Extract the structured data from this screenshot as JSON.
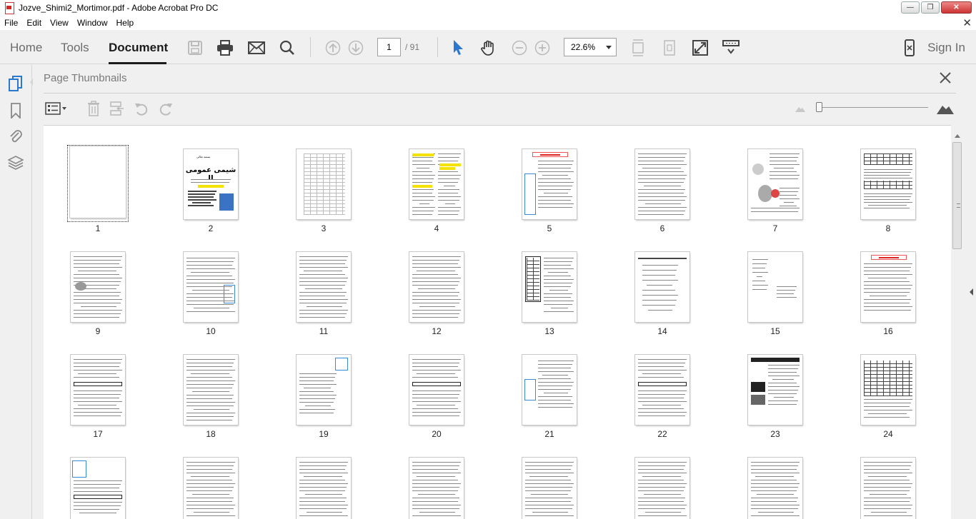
{
  "window": {
    "title": "Jozve_Shimi2_Mortimor.pdf - Adobe Acrobat Pro DC",
    "controls": {
      "minimize": "—",
      "restore": "❐",
      "close": "✕"
    }
  },
  "menu": {
    "items": [
      "File",
      "Edit",
      "View",
      "Window",
      "Help"
    ],
    "close_glyph": "✕"
  },
  "toolbar": {
    "tabs": [
      "Home",
      "Tools",
      "Document"
    ],
    "active_tab": "Document",
    "current_page": "1",
    "page_total": "/ 91",
    "zoom": "22.6%",
    "sign_in": "Sign In"
  },
  "panel": {
    "title": "Page Thumbnails",
    "thumbnail_size_level": 0.0
  },
  "thumbnails": {
    "selected_page": "1",
    "pages": [
      {
        "num": "1"
      },
      {
        "num": "2"
      },
      {
        "num": "3"
      },
      {
        "num": "4"
      },
      {
        "num": "5"
      },
      {
        "num": "6"
      },
      {
        "num": "7"
      },
      {
        "num": "8"
      },
      {
        "num": "9"
      },
      {
        "num": "10"
      },
      {
        "num": "11"
      },
      {
        "num": "12"
      },
      {
        "num": "13"
      },
      {
        "num": "14"
      },
      {
        "num": "15"
      },
      {
        "num": "16"
      },
      {
        "num": "17"
      },
      {
        "num": "18"
      },
      {
        "num": "19"
      },
      {
        "num": "20"
      },
      {
        "num": "21"
      },
      {
        "num": "22"
      },
      {
        "num": "23"
      },
      {
        "num": "24"
      },
      {
        "num": ""
      },
      {
        "num": ""
      },
      {
        "num": ""
      },
      {
        "num": ""
      },
      {
        "num": ""
      },
      {
        "num": ""
      },
      {
        "num": ""
      },
      {
        "num": ""
      }
    ],
    "cover": {
      "heading": "شیمی عمومی II",
      "small_top": "بسمه تعالی"
    }
  },
  "colors": {
    "accent": "#2a78d0",
    "highlight": "#f4e300",
    "title_red": "#d22222"
  }
}
